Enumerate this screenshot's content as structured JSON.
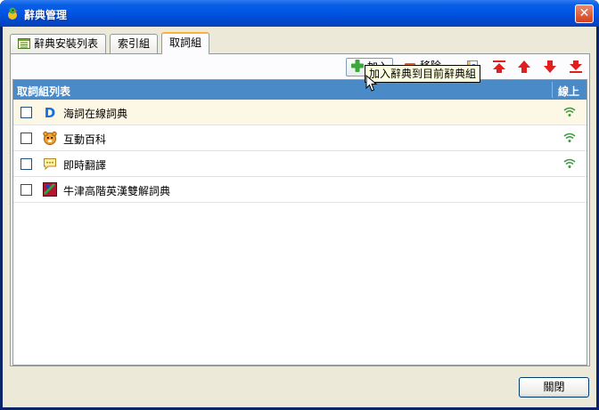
{
  "window": {
    "title": "辭典管理",
    "close_glyph": "✕"
  },
  "tabs": [
    {
      "label": "辭典安裝列表",
      "icon": "list-icon"
    },
    {
      "label": "索引組"
    },
    {
      "label": "取詞組",
      "active": true
    }
  ],
  "toolbar": {
    "add_label": "加入",
    "remove_label": "移除",
    "icons": [
      "info-icon",
      "move-top-icon",
      "move-up-icon",
      "move-down-icon",
      "move-bottom-icon"
    ]
  },
  "list": {
    "header_name": "取詞組列表",
    "header_online": "線上",
    "rows": [
      {
        "label": "海詞在線詞典",
        "icon": "dict-d-icon",
        "online": true,
        "selected": true
      },
      {
        "label": "互動百科",
        "icon": "tiger-icon",
        "online": true
      },
      {
        "label": "即時翻譯",
        "icon": "translate-icon",
        "online": true
      },
      {
        "label": "牛津高階英漢雙解詞典",
        "icon": "oxford-icon",
        "online": false
      }
    ]
  },
  "tooltip": "加入辭典到目前辭典組",
  "footer": {
    "close_label": "關閉"
  },
  "colors": {
    "header_bg": "#4a8ac6",
    "selected_row": "#fdf7e5",
    "online_icon": "#3a9a3a",
    "arrow_red": "#e02020"
  }
}
